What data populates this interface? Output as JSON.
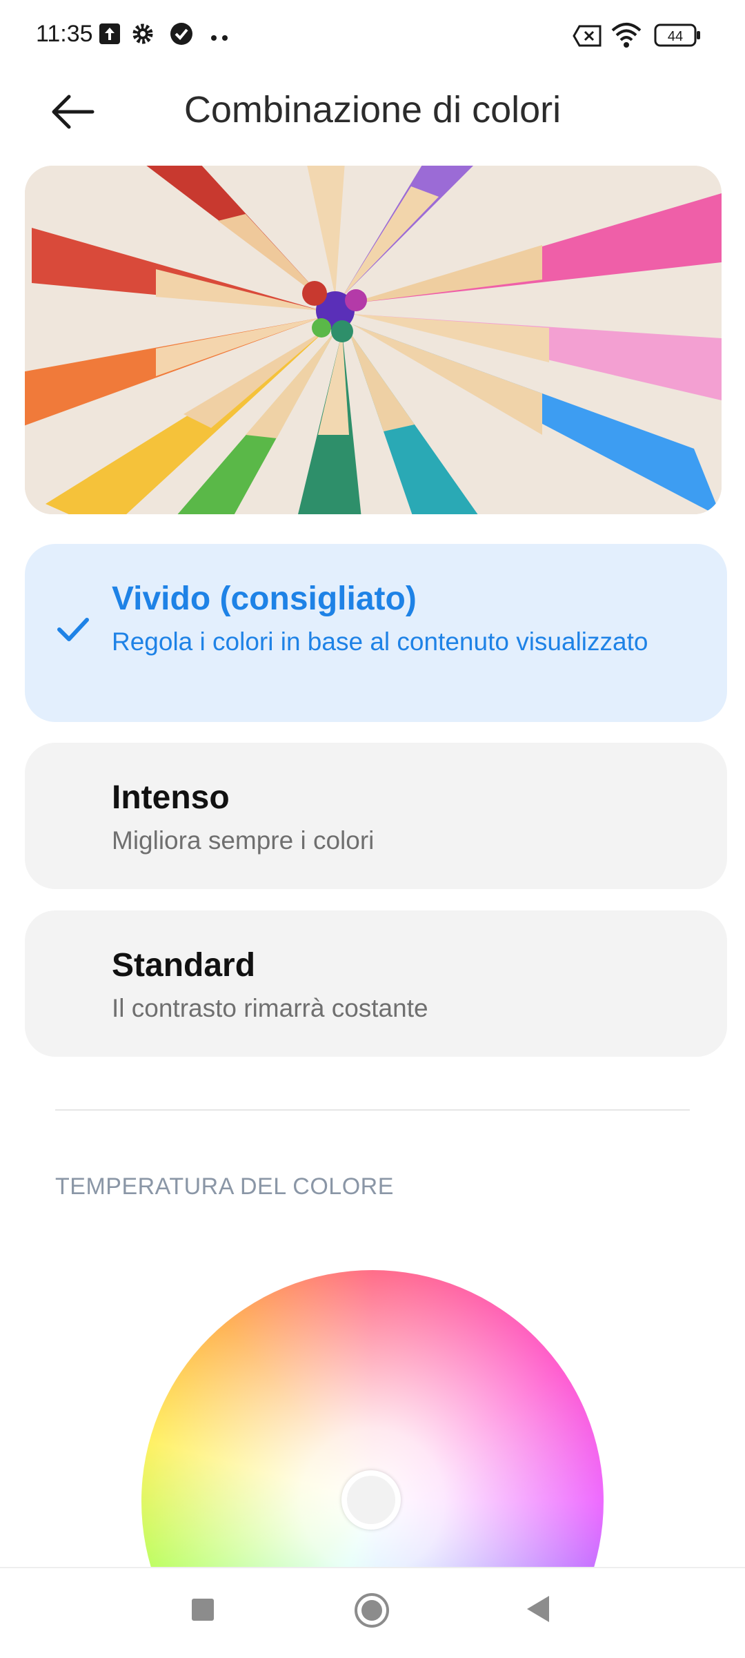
{
  "status_bar": {
    "time": "11:35",
    "battery": "44",
    "icons": [
      "upload-icon",
      "gear-icon",
      "check-circle-icon",
      "more-dots-icon",
      "no-sim-icon",
      "wifi-icon",
      "battery-icon"
    ]
  },
  "header": {
    "title": "Combinazione di colori",
    "back_icon": "back-arrow-icon"
  },
  "options": [
    {
      "title": "Vivido (consigliato)",
      "description": "Regola i colori in base al contenuto visualizzato",
      "selected": true
    },
    {
      "title": "Intenso",
      "description": "Migliora sempre i colori",
      "selected": false
    },
    {
      "title": "Standard",
      "description": "Il contrasto rimarrà costante",
      "selected": false
    }
  ],
  "section": {
    "label": "TEMPERATURA DEL COLORE"
  },
  "colors": {
    "accent": "#1e82e6",
    "selected_card": "#e3effd",
    "card": "#f3f3f3"
  },
  "nav_bar": {
    "icons": [
      "recents-square-icon",
      "home-circle-icon",
      "back-triangle-icon"
    ]
  }
}
